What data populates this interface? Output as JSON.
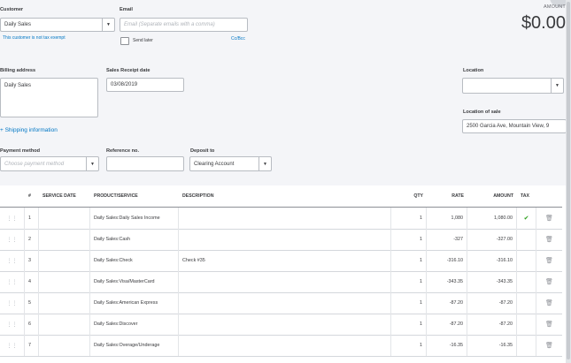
{
  "customer": {
    "label": "Customer",
    "value": "Daily Sales",
    "tax_note": "This customer is not tax exempt"
  },
  "email": {
    "label": "Email",
    "placeholder": "Email (Separate emails with a comma)",
    "send_later": "Send later",
    "cc_bcc": "Cc/Bcc"
  },
  "amount": {
    "label": "AMOUNT",
    "value": "$0.00"
  },
  "billing": {
    "label": "Billing address",
    "value": "Daily Sales"
  },
  "receipt_date": {
    "label": "Sales Receipt date",
    "value": "03/08/2019"
  },
  "location": {
    "label": "Location",
    "value": ""
  },
  "location_of_sale": {
    "label": "Location of sale",
    "value": "2500 Garcia Ave, Mountain View, 9"
  },
  "shipping": {
    "label": "+ Shipping information"
  },
  "payment_method": {
    "label": "Payment method",
    "placeholder": "Choose payment method"
  },
  "reference": {
    "label": "Reference no.",
    "value": ""
  },
  "deposit_to": {
    "label": "Deposit to",
    "value": "Clearing Account"
  },
  "colors": {
    "accent": "#0077c5",
    "tax_check": "#2ca01c"
  },
  "table": {
    "headers": {
      "num": "#",
      "service_date": "SERVICE DATE",
      "product": "PRODUCT/SERVICE",
      "description": "DESCRIPTION",
      "qty": "QTY",
      "rate": "RATE",
      "amount": "AMOUNT",
      "tax": "TAX"
    },
    "rows": [
      {
        "num": "1",
        "product": "Daily Sales:Daily Sales Income",
        "description": "",
        "qty": "1",
        "rate": "1,080",
        "amount": "1,080.00",
        "tax": true
      },
      {
        "num": "2",
        "product": "Daily Sales:Cash",
        "description": "",
        "qty": "1",
        "rate": "-327",
        "amount": "-327.00",
        "tax": false
      },
      {
        "num": "3",
        "product": "Daily Sales:Check",
        "description": "Check #35",
        "qty": "1",
        "rate": "-316.10",
        "amount": "-316.10",
        "tax": false
      },
      {
        "num": "4",
        "product": "Daily Sales:Visa/MasterCard",
        "description": "",
        "qty": "1",
        "rate": "-343.35",
        "amount": "-343.35",
        "tax": false
      },
      {
        "num": "5",
        "product": "Daily Sales:American Express",
        "description": "",
        "qty": "1",
        "rate": "-87.20",
        "amount": "-87.20",
        "tax": false
      },
      {
        "num": "6",
        "product": "Daily Sales:Discover",
        "description": "",
        "qty": "1",
        "rate": "-87.20",
        "amount": "-87.20",
        "tax": false
      },
      {
        "num": "7",
        "product": "Daily Sales:Overage/Underage",
        "description": "",
        "qty": "1",
        "rate": "-16.35",
        "amount": "-16.35",
        "tax": false
      }
    ]
  }
}
